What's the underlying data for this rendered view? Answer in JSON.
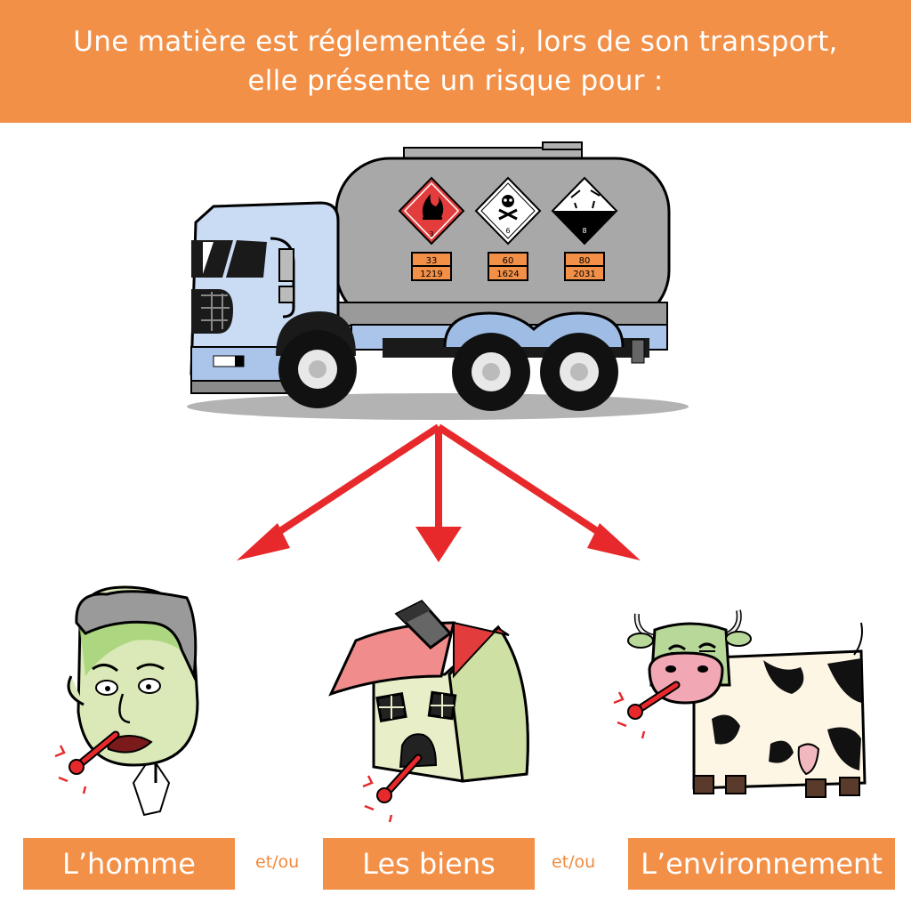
{
  "header": {
    "line1": "Une matière est réglementée si, lors de son transport,",
    "line2": "elle présente un risque pour :"
  },
  "placards": [
    {
      "class_number": "3",
      "hazard_code": "33",
      "un_number": "1219"
    },
    {
      "class_number": "6",
      "hazard_code": "60",
      "un_number": "1624"
    },
    {
      "class_number": "8",
      "hazard_code": "80",
      "un_number": "2031"
    }
  ],
  "targets": [
    {
      "label": "L’homme"
    },
    {
      "label": "Les biens"
    },
    {
      "label": "L’environnement"
    }
  ],
  "connector": "et/ou",
  "colors": {
    "banner": "#f39048",
    "arrow": "#e8292b",
    "label_bg": "#f39048",
    "connector": "#f08a3c"
  }
}
